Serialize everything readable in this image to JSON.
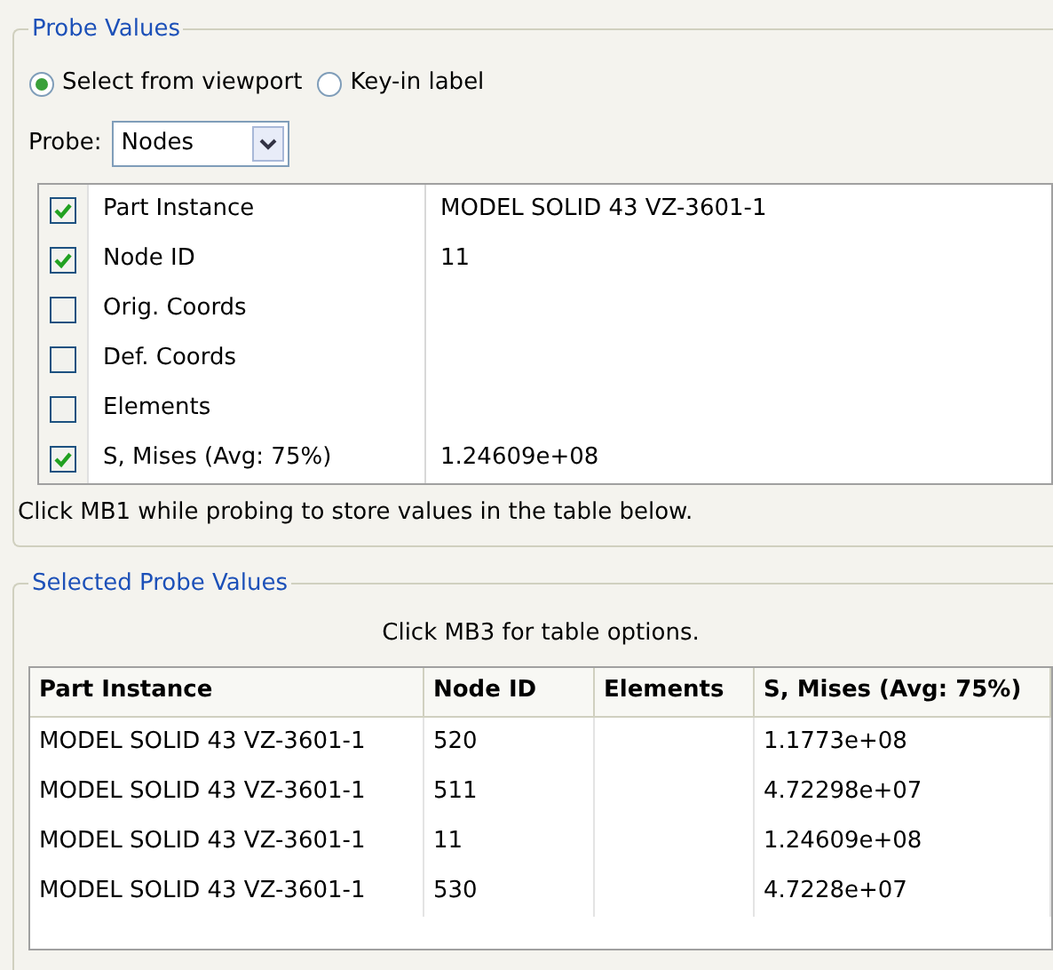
{
  "probe_values": {
    "title": "Probe Values",
    "radios": [
      {
        "label": "Select from viewport",
        "selected": true
      },
      {
        "label": "Key-in label",
        "selected": false
      }
    ],
    "probe": {
      "label": "Probe:",
      "value": "Nodes"
    },
    "fields": [
      {
        "label": "Part Instance",
        "checked": true,
        "value": "MODEL SOLID 43 VZ-3601-1"
      },
      {
        "label": "Node ID",
        "checked": true,
        "value": "11"
      },
      {
        "label": "Orig. Coords",
        "checked": false
      },
      {
        "label": "Def. Coords",
        "checked": false
      },
      {
        "label": "Elements",
        "checked": false
      },
      {
        "label": "S, Mises (Avg: 75%)",
        "checked": true,
        "value": "1.24609e+08"
      }
    ],
    "hint": "Click MB1 while probing to store values in the table below."
  },
  "selected_probe_values": {
    "title": "Selected Probe Values",
    "hint": "Click MB3 for table options.",
    "columns": [
      "Part Instance",
      "Node ID",
      "Elements",
      "S, Mises (Avg: 75%)"
    ],
    "rows": [
      [
        "MODEL SOLID 43 VZ-3601-1",
        "520",
        "",
        "1.1773e+08"
      ],
      [
        "MODEL SOLID 43 VZ-3601-1",
        "511",
        "",
        "4.72298e+07"
      ],
      [
        "MODEL SOLID 43 VZ-3601-1",
        "11",
        "",
        "1.24609e+08"
      ],
      [
        "MODEL SOLID 43 VZ-3601-1",
        "530",
        "",
        "4.7228e+07"
      ]
    ]
  }
}
